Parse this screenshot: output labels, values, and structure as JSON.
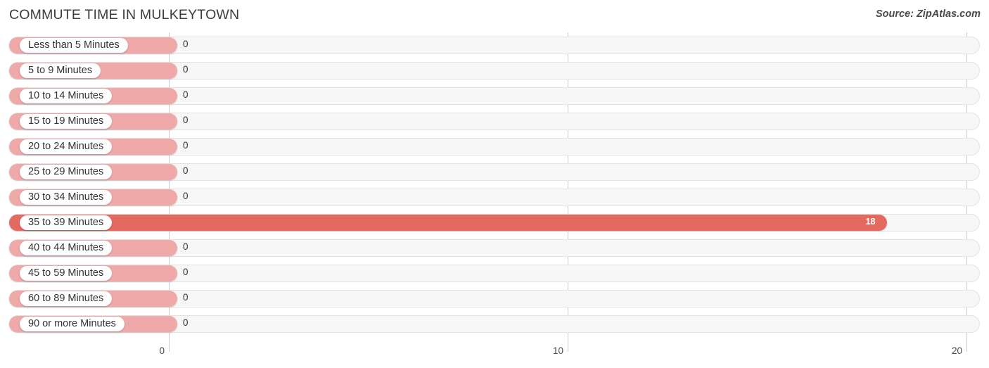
{
  "header": {
    "title": "COMMUTE TIME IN MULKEYTOWN",
    "source": "Source: ZipAtlas.com"
  },
  "colors": {
    "bar": "#f0a9a9",
    "bar_highlight": "#e4695f",
    "track": "#f7f7f7",
    "gridline": "#c9c9c9",
    "text": "#333333"
  },
  "axis": {
    "ticks": [
      "0",
      "10",
      "20"
    ],
    "min": 0,
    "max": 20
  },
  "chart_data": {
    "type": "bar",
    "orientation": "horizontal",
    "title": "COMMUTE TIME IN MULKEYTOWN",
    "xlabel": "",
    "ylabel": "",
    "xlim": [
      0,
      20
    ],
    "grid": true,
    "legend": null,
    "categories": [
      "Less than 5 Minutes",
      "5 to 9 Minutes",
      "10 to 14 Minutes",
      "15 to 19 Minutes",
      "20 to 24 Minutes",
      "25 to 29 Minutes",
      "30 to 34 Minutes",
      "35 to 39 Minutes",
      "40 to 44 Minutes",
      "45 to 59 Minutes",
      "60 to 89 Minutes",
      "90 or more Minutes"
    ],
    "values": [
      0,
      0,
      0,
      0,
      0,
      0,
      0,
      18,
      0,
      0,
      0,
      0
    ],
    "value_labels": [
      "0",
      "0",
      "0",
      "0",
      "0",
      "0",
      "0",
      "18",
      "0",
      "0",
      "0",
      "0"
    ],
    "highlighted_index": 7
  }
}
